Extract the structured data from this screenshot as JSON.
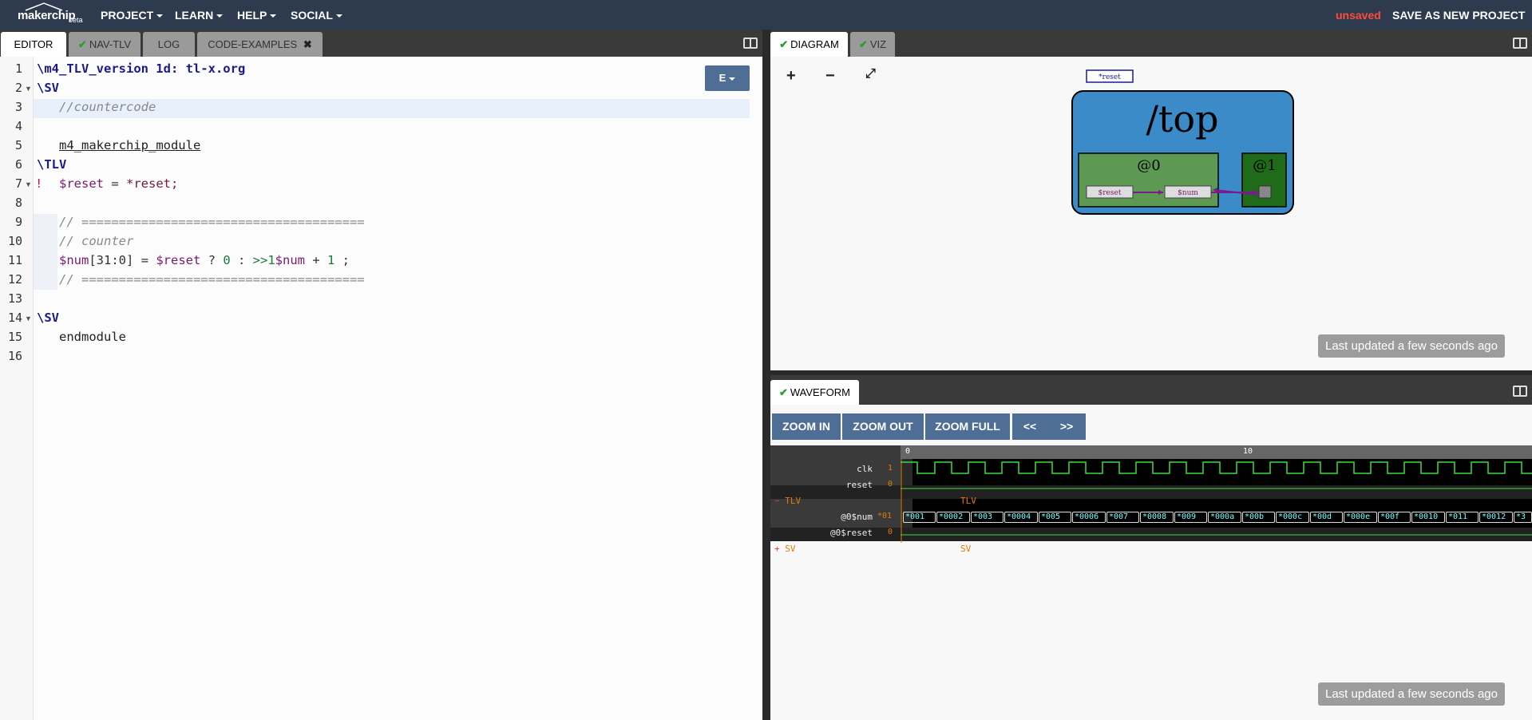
{
  "topbar": {
    "logo_text": "makerchip",
    "beta": "beta",
    "menus": [
      "PROJECT",
      "LEARN",
      "HELP",
      "SOCIAL"
    ],
    "unsaved": "unsaved",
    "save_as": "SAVE AS NEW PROJECT"
  },
  "left_tabs": [
    "EDITOR",
    "NAV-TLV",
    "LOG",
    "CODE-EXAMPLES"
  ],
  "editor": {
    "mode_button": "E",
    "line_numbers": [
      "1",
      "2",
      "3",
      "4",
      "5",
      "6",
      "7",
      "8",
      "9",
      "10",
      "11",
      "12",
      "13",
      "14",
      "15",
      "16"
    ],
    "lines": {
      "l1": "\\m4_TLV_version 1d: tl-x.org",
      "l2": "\\SV",
      "l3": "//countercode",
      "l5": "m4_makerchip_module",
      "l6": "\\TLV",
      "l7_mark": "!",
      "l7_a": "$reset",
      "l7_b": " = ",
      "l7_c": "*reset;",
      "l9": "// ======================================",
      "l10": "// counter",
      "l11_a": "$num",
      "l11_b": "[31:0] = ",
      "l11_c": "$reset",
      "l11_d": " ? ",
      "l11_e": "0",
      "l11_f": " : ",
      "l11_g": ">>1",
      "l11_h": "$num",
      "l11_i": " + ",
      "l11_j": "1",
      "l11_k": " ;",
      "l12": "// ======================================",
      "l14": "\\SV",
      "l15": "endmodule"
    }
  },
  "right_tabs": [
    "DIAGRAM",
    "VIZ"
  ],
  "diagram": {
    "controls": [
      "+",
      "−",
      "⤢"
    ],
    "input_label": "*reset",
    "top_label": "/top",
    "stage0": "@0",
    "stage1": "@1",
    "sig_reset": "$reset",
    "sig_num": "$num",
    "updated": "Last updated a few seconds ago"
  },
  "waveform": {
    "tab": "WAVEFORM",
    "buttons": [
      "ZOOM IN",
      "ZOOM OUT",
      "ZOOM FULL",
      "<<",
      ">>"
    ],
    "ticks": [
      "0",
      "10"
    ],
    "rows": [
      {
        "label": "clk",
        "value": "1"
      },
      {
        "label": "reset",
        "value": "0"
      },
      {
        "label": "TLV",
        "sign": "−"
      },
      {
        "label": "@0$num",
        "value": "*01"
      },
      {
        "label": "@0$reset",
        "value": "0"
      },
      {
        "label": "SV",
        "sign": "+"
      }
    ],
    "scope_tlv": "TLV",
    "scope_sv": "SV",
    "num_values": [
      "*001",
      "*0002",
      "*003",
      "*0004",
      "*005",
      "*0006",
      "*007",
      "*0008",
      "*009",
      "*000a",
      "*00b",
      "*000c",
      "*00d",
      "*000e",
      "*00f",
      "*0010",
      "*011",
      "*0012",
      "*3"
    ],
    "updated": "Last updated a few seconds ago"
  },
  "colors": {
    "topbar": "#2e3b4f",
    "accent_button": "#4f6e95",
    "unsaved": "#ff4b3e",
    "diagram_top": "#3a8bc7",
    "stage0": "#5e9954",
    "stage1": "#1f6b1a",
    "wave_green": "#3ddc3d"
  }
}
